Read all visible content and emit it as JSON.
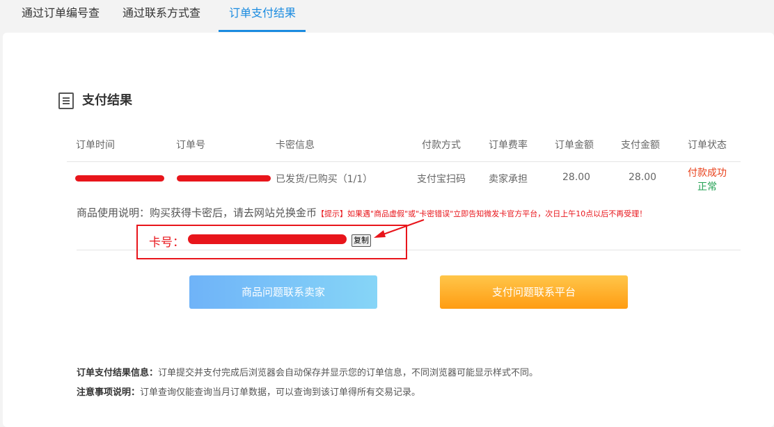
{
  "tabs": [
    {
      "label": "通过订单编号查"
    },
    {
      "label": "通过联系方式查"
    },
    {
      "label": "订单支付结果"
    }
  ],
  "section": {
    "title": "支付结果"
  },
  "table": {
    "headers": [
      "订单时间",
      "订单号",
      "卡密信息",
      "付款方式",
      "订单费率",
      "订单金额",
      "支付金额",
      "订单状态"
    ],
    "row": {
      "card_info": "已发货/已购买（1/1）",
      "pay_method": "支付宝扫码",
      "fee": "卖家承担",
      "order_amount": "28.00",
      "paid_amount": "28.00",
      "status_pay": "付款成功",
      "status_normal": "正常"
    }
  },
  "usage": {
    "text": "商品使用说明：购买获得卡密后，请去网站兑换金币",
    "tip": "【提示】如果遇\"商品虚假\"或\"卡密错误\"立即告知微发卡官方平台，次日上午10点以后不再受理！"
  },
  "card": {
    "label": "卡号：",
    "copy_label": "复制"
  },
  "buttons": {
    "seller": "商品问题联系卖家",
    "platform": "支付问题联系平台"
  },
  "notes": {
    "info_label": "订单支付结果信息：",
    "info_text": "订单提交并支付完成后浏览器会自动保存并显示您的订单信息，不同浏览器可能显示样式不同。",
    "notice_label": "注意事项说明：",
    "notice_text": "订单查询仅能查询当月订单数据，可以查询到该订单得所有交易记录。"
  },
  "colors": {
    "accent": "#1a8be0",
    "highlight": "#e8151b",
    "success": "#22a052"
  }
}
